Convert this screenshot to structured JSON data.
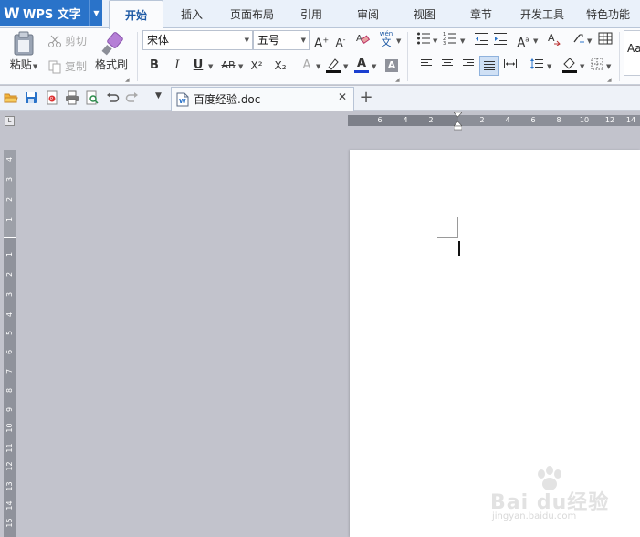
{
  "app": {
    "logo": "W",
    "name": "WPS 文字"
  },
  "menu_tabs": [
    {
      "label": "开始",
      "active": true
    },
    {
      "label": "插入"
    },
    {
      "label": "页面布局"
    },
    {
      "label": "引用"
    },
    {
      "label": "审阅"
    },
    {
      "label": "视图"
    },
    {
      "label": "章节"
    },
    {
      "label": "开发工具"
    },
    {
      "label": "特色功能"
    }
  ],
  "ribbon": {
    "clipboard": {
      "paste_label": "粘贴",
      "cut_label": "剪切",
      "copy_label": "复制",
      "format_painter_label": "格式刷"
    },
    "font": {
      "font_name": "宋体",
      "font_size": "五号",
      "bold": "B",
      "italic": "I",
      "underline": "U",
      "strike": "AB",
      "superscript": "X²",
      "subscript": "X₂",
      "font_color_letter": "A",
      "char_shade_letter": "A",
      "pinyin_top": "wén",
      "pinyin_bottom": "文"
    },
    "styles": {
      "preview": "Aa"
    }
  },
  "document_tab": {
    "name": "百度经验.doc"
  },
  "rulers": {
    "horizontal_ticks": [
      "6",
      "4",
      "2",
      "2",
      "4",
      "6",
      "8",
      "10",
      "12",
      "14"
    ],
    "vertical_ticks": [
      "4",
      "3",
      "2",
      "1",
      "1",
      "2",
      "3",
      "4",
      "5",
      "6",
      "7",
      "8",
      "9",
      "10",
      "11",
      "12",
      "13",
      "14",
      "15"
    ]
  },
  "watermark": {
    "text": "Bai du经验",
    "sub": "jingyan.baidu.com"
  },
  "colors": {
    "app_blue": "#2a73c9",
    "active_tab_text": "#1e5aa5",
    "font_color_bar": "#1a3fd0",
    "workspace_gray": "#c2c3cc"
  }
}
